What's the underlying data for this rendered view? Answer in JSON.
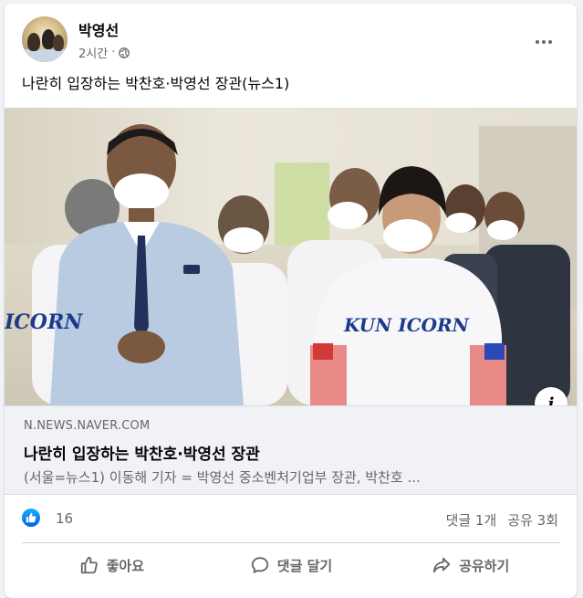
{
  "post": {
    "author": "박영선",
    "time": "2시간",
    "separator": "·",
    "text": "나란히 입장하는 박찬호·박영선 장관(뉴스1)"
  },
  "link": {
    "domain": "N.NEWS.NAVER.COM",
    "title": "나란히 입장하는 박찬호·박영선 장관",
    "description": "(서울=뉴스1) 이동해 기자 = 박영선 중소벤처기업부 장관, 박찬호 ..."
  },
  "photo": {
    "shirt_text_left": "ICORN",
    "shirt_text_center": "KUN ICORN",
    "info_label": "i"
  },
  "engagement": {
    "reaction_count": "16",
    "comments": "댓글 1개",
    "shares": "공유 3회"
  },
  "actions": {
    "like": "좋아요",
    "comment": "댓글 달기",
    "share": "공유하기"
  },
  "colors": {
    "like_blue": "#1877f2",
    "secondary_text": "#65676b",
    "card_bg": "#ffffff",
    "preview_bg": "#f0f2f5"
  },
  "icons": [
    "globe-icon",
    "more-icon",
    "info-icon",
    "like-reaction-icon",
    "thumbs-up-icon",
    "comment-icon",
    "share-icon"
  ]
}
